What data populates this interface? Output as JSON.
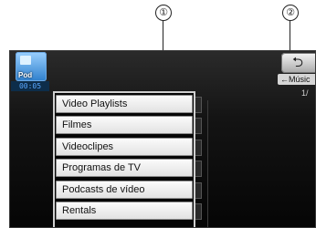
{
  "callouts": {
    "one": "①",
    "two": "②"
  },
  "source": {
    "icon_name": "ipod-icon",
    "label": "Pod",
    "timer": "00:05"
  },
  "header": {
    "back_icon": "back-arrow-icon",
    "back_glyph": "⮌",
    "music_label": "←Músic",
    "page_indicator": "1/"
  },
  "menu": {
    "items": [
      {
        "label": "Video Playlists"
      },
      {
        "label": "Filmes"
      },
      {
        "label": "Videoclipes"
      },
      {
        "label": "Programas de TV"
      },
      {
        "label": "Podcasts de vídeo"
      },
      {
        "label": "Rentals"
      }
    ]
  },
  "colors": {
    "accent": "#5aa8ff",
    "screen_bg": "#0a0a0a",
    "item_bg": "#f2f2f2"
  }
}
